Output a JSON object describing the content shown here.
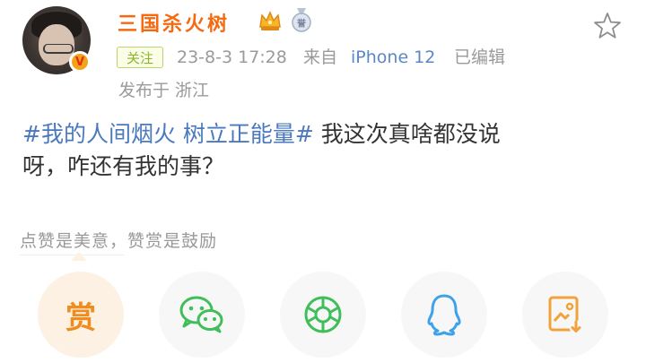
{
  "post": {
    "author": {
      "name": "三国杀火树",
      "verified_badge": "V",
      "crown_icon": "crown-icon",
      "medal_icon": "medal-icon"
    },
    "follow_label": "关注",
    "date": "23-8-3 17:28",
    "source_prefix": "来自",
    "device": "iPhone 12",
    "edited_label": "已编辑",
    "location": "发布于 浙江",
    "hashtag": "#我的人间烟火 树立正能量#",
    "text_line1_rest": " 我这次真啥都没说",
    "text_line2": "呀，咋还有我的事？"
  },
  "reward": {
    "hint": "点赞是美意，赞赏是鼓励",
    "reward_glyph": "赏"
  },
  "share": {
    "items": [
      "reward",
      "wechat",
      "moments",
      "qq",
      "save-image"
    ]
  },
  "colors": {
    "username": "#f56a10",
    "hashtag": "#4a79bf",
    "follow": "#8ab526",
    "device": "#5b88c5",
    "reward": "#f08b1e",
    "wechat": "#3fbe5a",
    "qq": "#3ea2e8"
  }
}
